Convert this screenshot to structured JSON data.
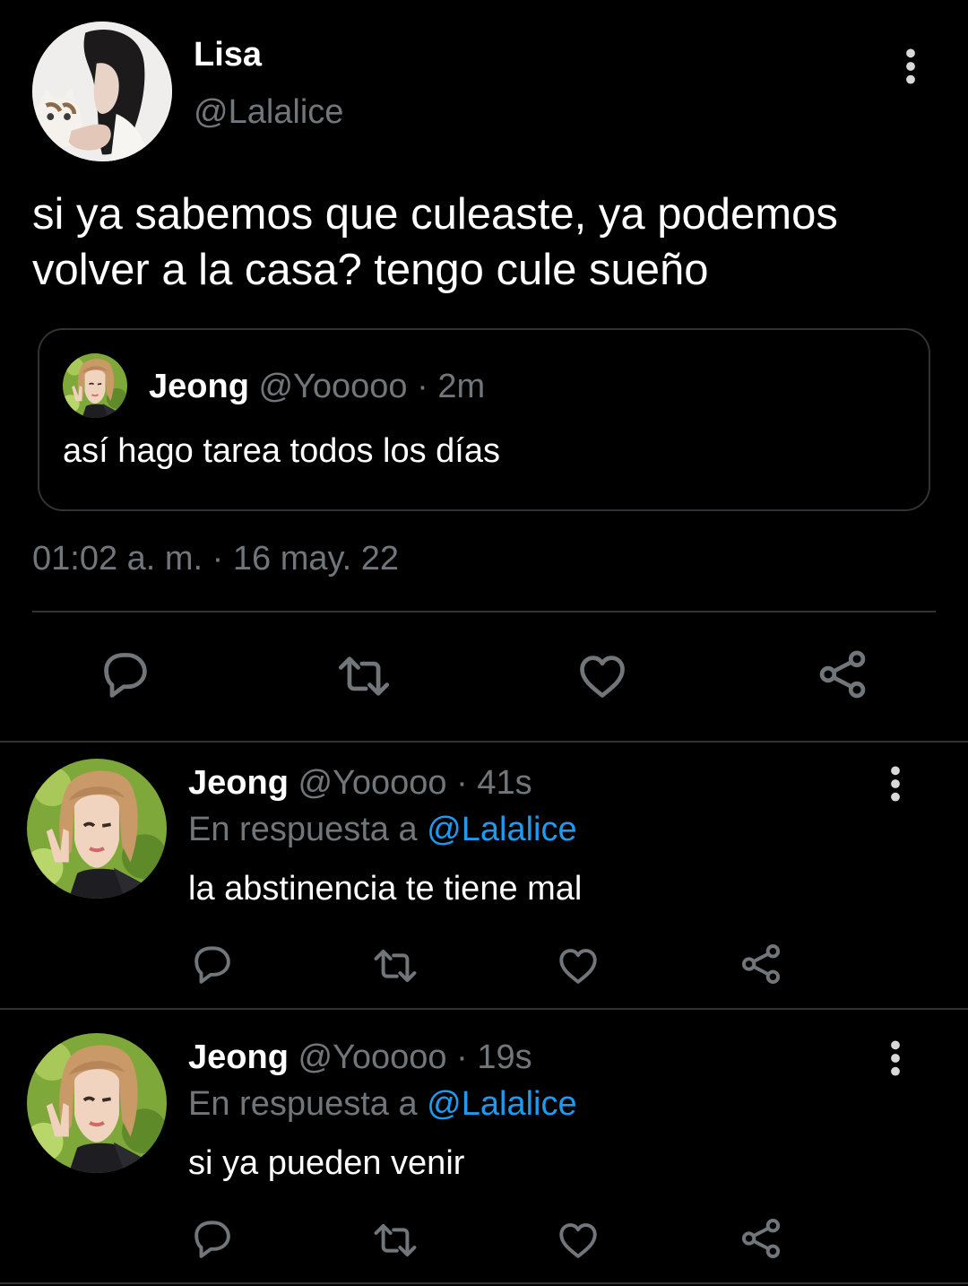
{
  "main_tweet": {
    "name": "Lisa",
    "handle": "@Lalalice",
    "text_line1": "si ya sabemos que culeaste, ya podemos",
    "text_line2": "volver a la casa? tengo cule sueño",
    "quoted": {
      "name": "Jeong",
      "handle": "@Yooooo",
      "separator": "·",
      "time": "2m",
      "text": "así hago tarea todos los días"
    },
    "timestamp": "01:02 a. m. · 16 may. 22",
    "actions": [
      "reply-icon",
      "retweet-icon",
      "like-icon",
      "share-icon"
    ]
  },
  "replies": [
    {
      "name": "Jeong",
      "handle": "@Yooooo",
      "separator": "·",
      "time": "41s",
      "context_prefix": "En respuesta a",
      "context_handle": "@Lalalice",
      "text": "la abstinencia te tiene mal"
    },
    {
      "name": "Jeong",
      "handle": "@Yooooo",
      "separator": "·",
      "time": "19s",
      "context_prefix": "En respuesta a",
      "context_handle": "@Lalalice",
      "text": "si ya pueden venir"
    }
  ],
  "colors": {
    "background": "#000000",
    "text": "#e7e9ea",
    "secondary": "#71767b",
    "link": "#1d9bf0",
    "divider": "#2f3336"
  }
}
